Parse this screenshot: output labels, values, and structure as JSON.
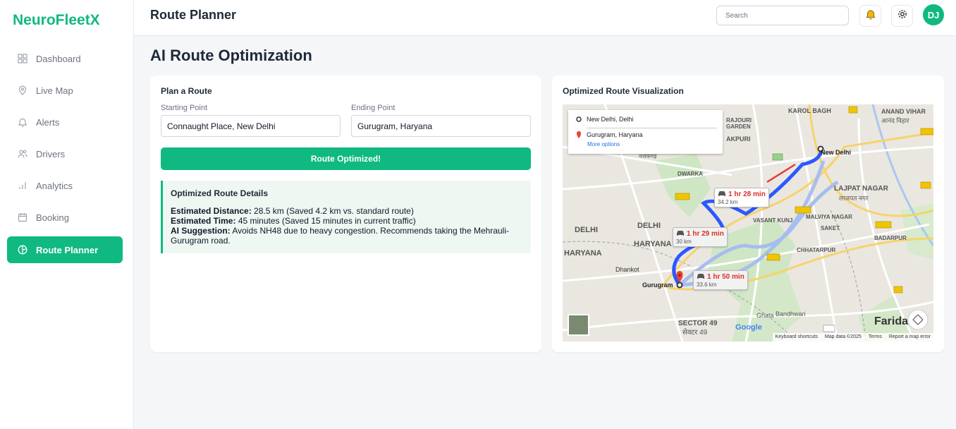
{
  "sidebar": {
    "brand": "NeuroFleetX",
    "items": [
      {
        "label": "Dashboard",
        "icon": "grid-icon",
        "active": false
      },
      {
        "label": "Live Map",
        "icon": "map-pin-icon",
        "active": false
      },
      {
        "label": "Alerts",
        "icon": "bell-icon",
        "active": false
      },
      {
        "label": "Drivers",
        "icon": "users-icon",
        "active": false
      },
      {
        "label": "Analytics",
        "icon": "bar-chart-icon",
        "active": false
      },
      {
        "label": "Booking",
        "icon": "calendar-icon",
        "active": false
      },
      {
        "label": "Route Planner",
        "icon": "compass-icon",
        "active": true
      }
    ]
  },
  "header": {
    "title": "Route Planner",
    "search_placeholder": "Search",
    "avatar_initials": "DJ"
  },
  "main": {
    "page_title": "AI Route Optimization",
    "plan": {
      "title": "Plan a Route",
      "start_label": "Starting Point",
      "start_value": "Connaught Place, New Delhi",
      "end_label": "Ending Point",
      "end_value": "Gurugram, Haryana",
      "button_label": "Route Optimized!",
      "details": {
        "title": "Optimized Route Details",
        "distance_label": "Estimated Distance:",
        "distance_value": "28.5 km (Saved 4.2 km vs. standard route)",
        "time_label": "Estimated Time:",
        "time_value": "45 minutes (Saved 15 minutes in current traffic)",
        "suggestion_label": "AI Suggestion:",
        "suggestion_value": "Avoids NH48 due to heavy congestion. Recommends taking the Mehrauli-Gurugram road."
      }
    },
    "visualization": {
      "title": "Optimized Route Visualization",
      "map": {
        "origin": "New Delhi, Delhi",
        "destination": "Gurugram, Haryana",
        "more_options": "More options",
        "routes": [
          {
            "time": "1 hr 28 min",
            "distance": "34.2 km"
          },
          {
            "time": "1 hr 29 min",
            "distance": "30 km"
          },
          {
            "time": "1 hr 50 min",
            "distance": "33.6 km"
          }
        ],
        "places": {
          "new_delhi": "New Delhi",
          "gurugram": "Gurugram",
          "karol_bagh": "KAROL BAGH",
          "anand_vihar": "ANAND VIHAR",
          "anand_vihar_hi": "आनंद विहार",
          "rajouri": "RAJOURI",
          "garden": "GARDEN",
          "akpuri": "AKPURI",
          "najafgarh": "नजफगढ़",
          "dwarka": "DWARKA",
          "lajpat_nagar": "LAJPAT NAGAR",
          "lajpat_nagar_hi": "लाजपत नगर",
          "vasant_kunj": "VASANT KUNJ",
          "malviya_nagar": "MALVIYA NAGAR",
          "saket": "SAKET",
          "delhi_1": "DELHI",
          "delhi_2": "DELHI",
          "haryana_1": "HARYANA",
          "haryana_2": "HARYANA",
          "chhatarpur": "CHHATARPUR",
          "badarpur": "BADARPUR",
          "dhankot": "Dhankot",
          "ghata": "Ghata",
          "bandhwari": "Bandhwari",
          "sector_49": "SECTOR 49",
          "sector_49_hi": "सेक्टर 49",
          "faridabad": "Farida"
        },
        "google": "Google",
        "attribution": [
          "Keyboard shortcuts",
          "Map data ©2025",
          "Terms",
          "Report a map error"
        ]
      }
    }
  },
  "colors": {
    "accent": "#10b981",
    "route": "#2b59ff",
    "route_alt": "#a7bdf0",
    "traffic": "#e53935"
  }
}
